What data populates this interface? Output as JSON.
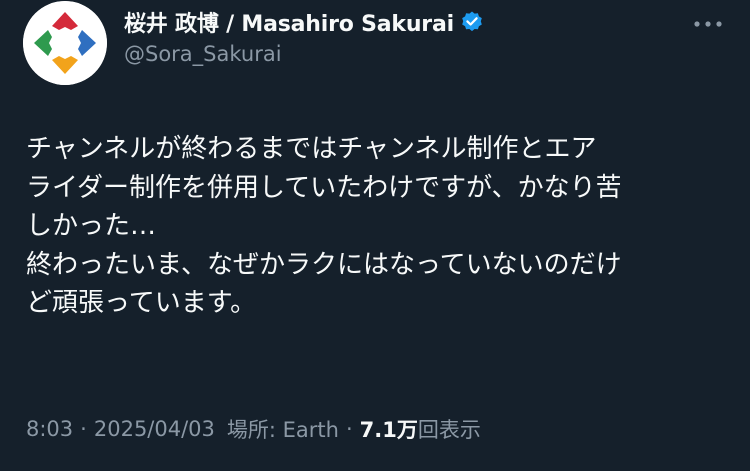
{
  "author": {
    "display_name": "桜井 政博 / Masahiro Sakurai",
    "handle": "@Sora_Sakurai",
    "verified": true
  },
  "icons": {
    "avatar": "avatar-compass-arrows",
    "verified": "verified-badge-icon",
    "more": "more-horizontal-icon"
  },
  "post": {
    "lines": [
      "チャンネルが終わるまではチャンネル制作とエア",
      "ライダー制作を併用していたわけですが、かなり苦",
      "しかった…",
      "終わったいま、なぜかラクにはなっていないのだけ",
      "ど頑張っています。"
    ]
  },
  "meta": {
    "time": "8:03",
    "separator": "·",
    "date": "2025/04/03",
    "location": "場所: Earth",
    "views_count": "7.1万",
    "views_label": "回表示"
  },
  "colors": {
    "background": "#15202b",
    "text_primary": "#f7f9f9",
    "text_secondary": "#8b98a5",
    "verified": "#1d9bf0",
    "avatar_red": "#d42a3a",
    "avatar_green": "#2e9a4e",
    "avatar_blue": "#2f6fc0",
    "avatar_yellow": "#f2a31b"
  }
}
